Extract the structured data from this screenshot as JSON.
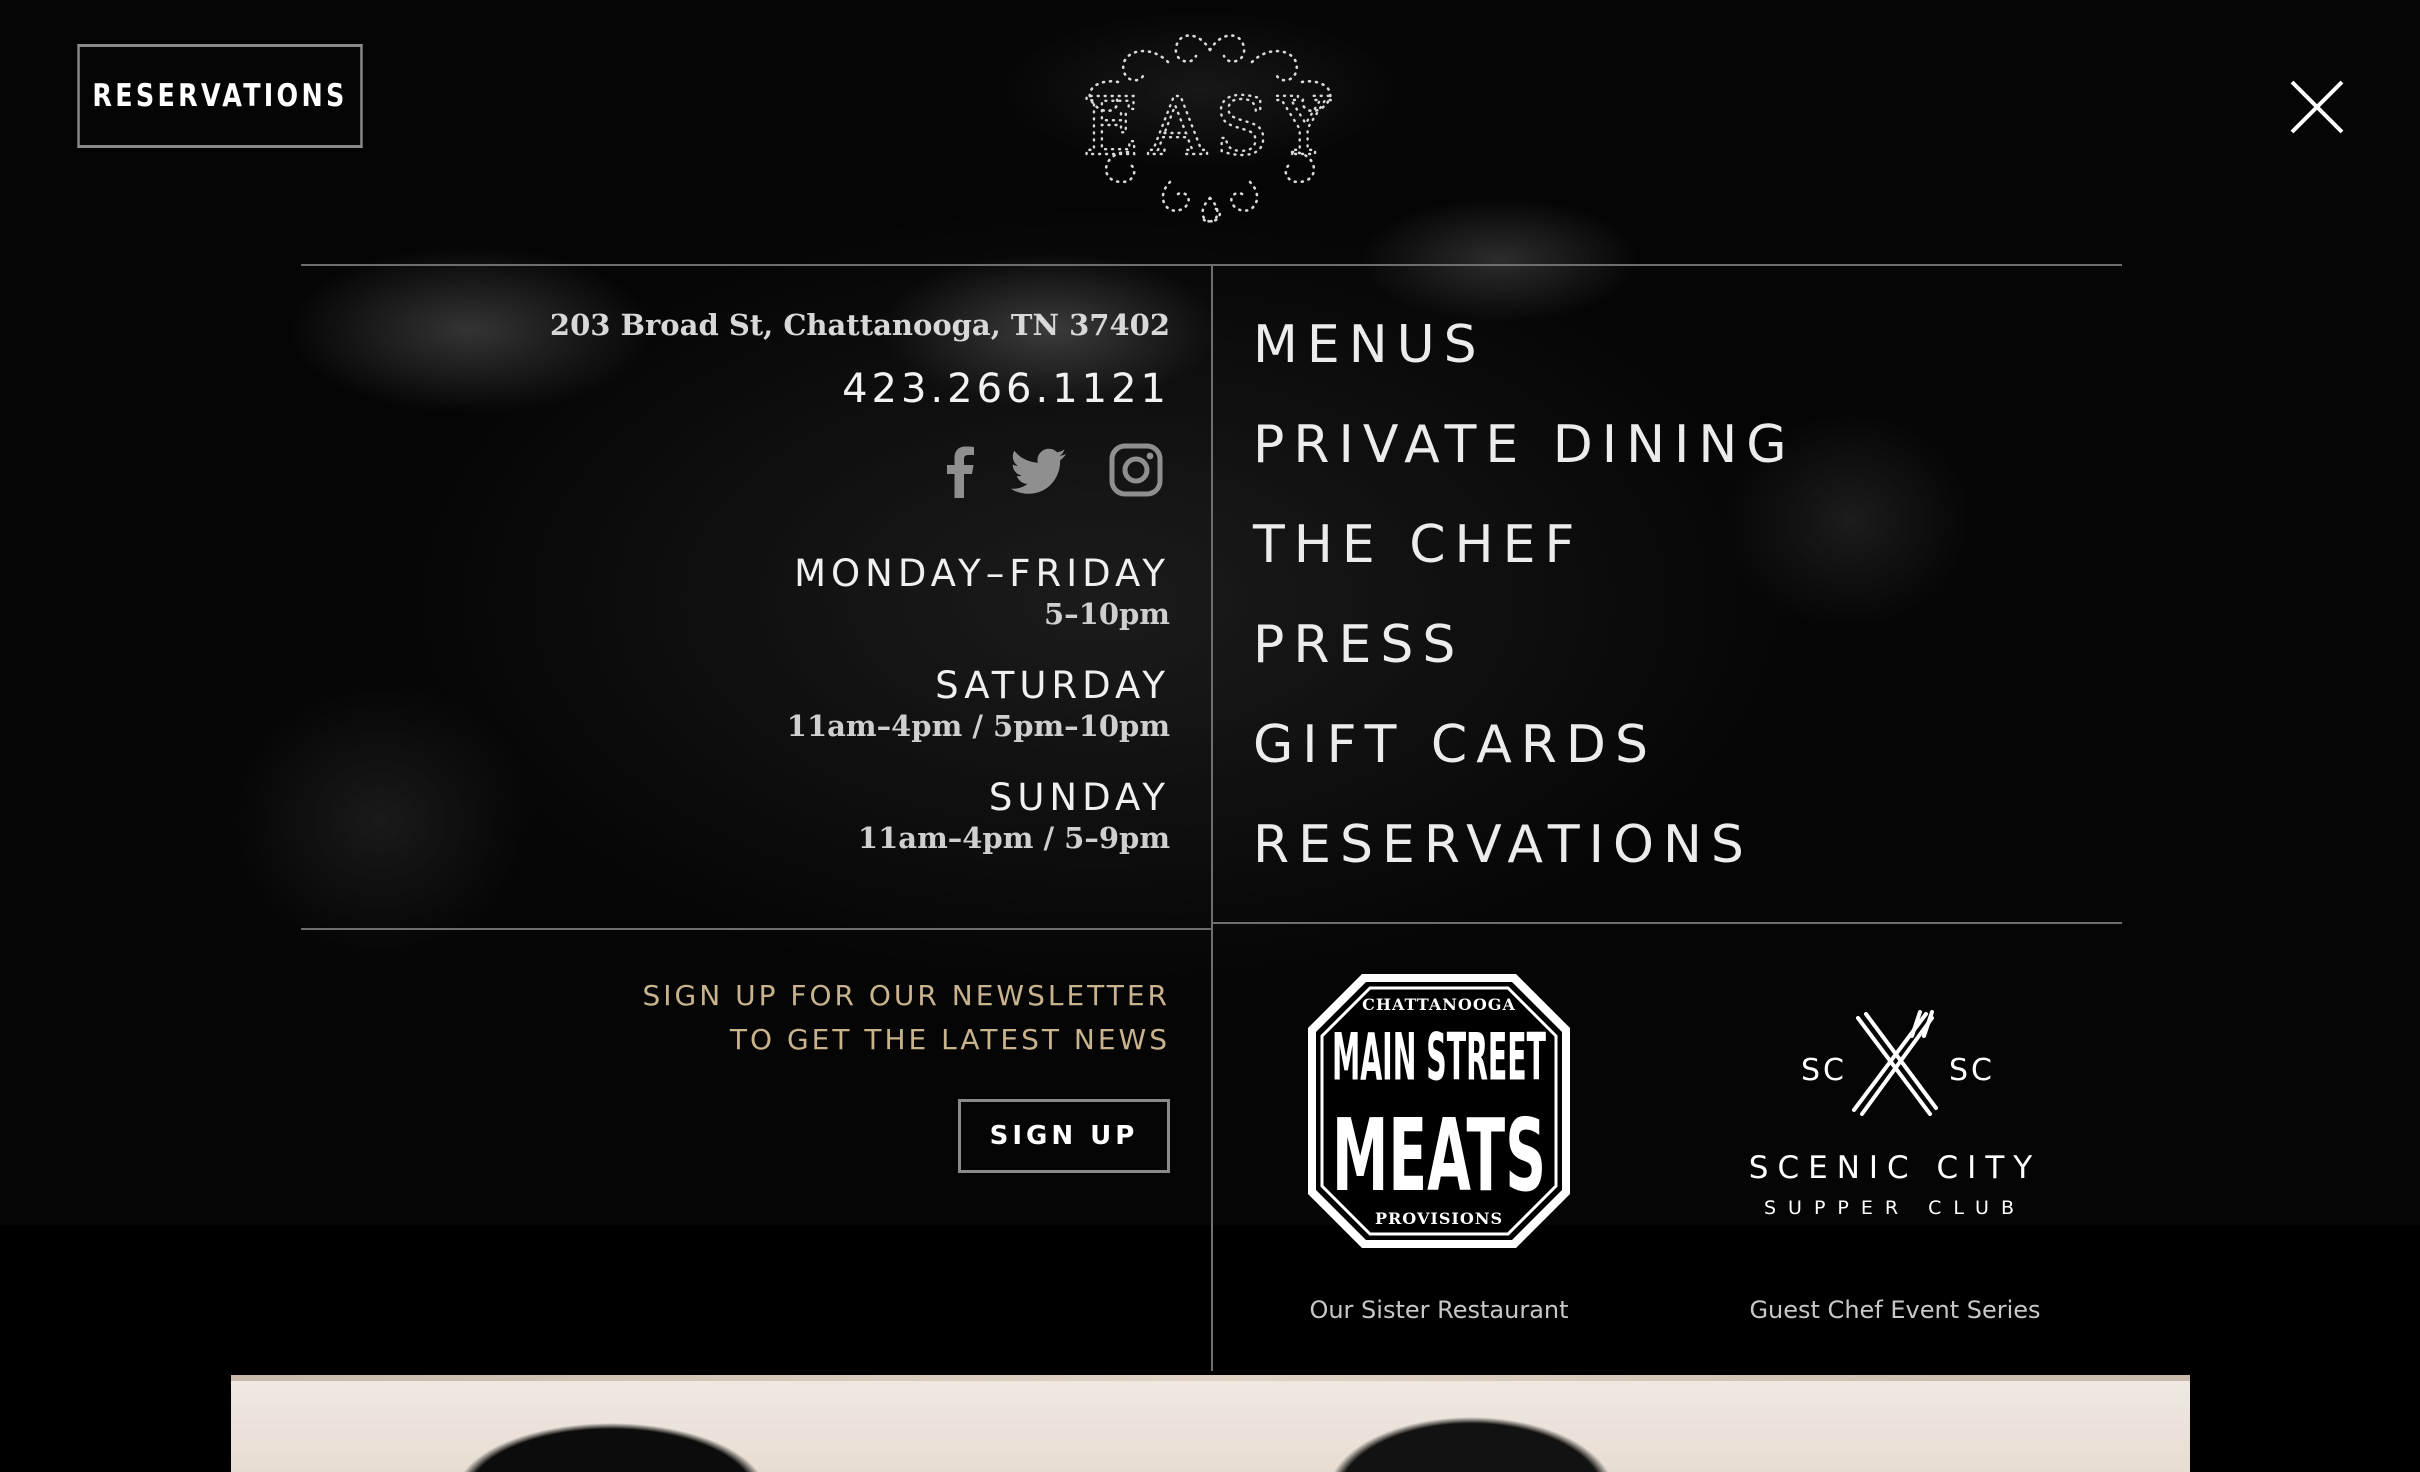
{
  "header": {
    "reservations_label": "RESERVATIONS",
    "logo_text": "EASY",
    "close_icon": "close-icon"
  },
  "contact": {
    "address": "203 Broad St, Chattanooga, TN 37402",
    "phone": "423.266.1121",
    "social_icons": [
      "facebook-icon",
      "twitter-icon",
      "instagram-icon"
    ]
  },
  "hours": [
    {
      "day": "MONDAY–FRIDAY",
      "time": "5–10pm"
    },
    {
      "day": "SATURDAY",
      "time": "11am–4pm / 5pm–10pm"
    },
    {
      "day": "SUNDAY",
      "time": "11am–4pm / 5–9pm"
    }
  ],
  "newsletter": {
    "line1": "SIGN UP FOR OUR NEWSLETTER",
    "line2": "TO GET THE LATEST NEWS",
    "button_label": "SIGN UP"
  },
  "nav": {
    "items": [
      "MENUS",
      "PRIVATE DINING",
      "THE CHEF",
      "PRESS",
      "GIFT CARDS",
      "RESERVATIONS"
    ]
  },
  "partners": {
    "msm": {
      "logo_top": "CHATTANOOGA",
      "logo_line1": "MAIN STREET",
      "logo_line2": "MEATS",
      "logo_bottom": "PROVISIONS",
      "caption": "Our Sister Restaurant"
    },
    "scc": {
      "logo_left": "SC",
      "logo_right": "SC",
      "logo_line1": "SCENIC CITY",
      "logo_line2": "SUPPER CLUB",
      "caption": "Guest Chef Event Series"
    }
  },
  "colors": {
    "newsletter_gold": "#c9b38d",
    "border_gray": "#8a8a8a",
    "divider": "#6e6e6e"
  }
}
